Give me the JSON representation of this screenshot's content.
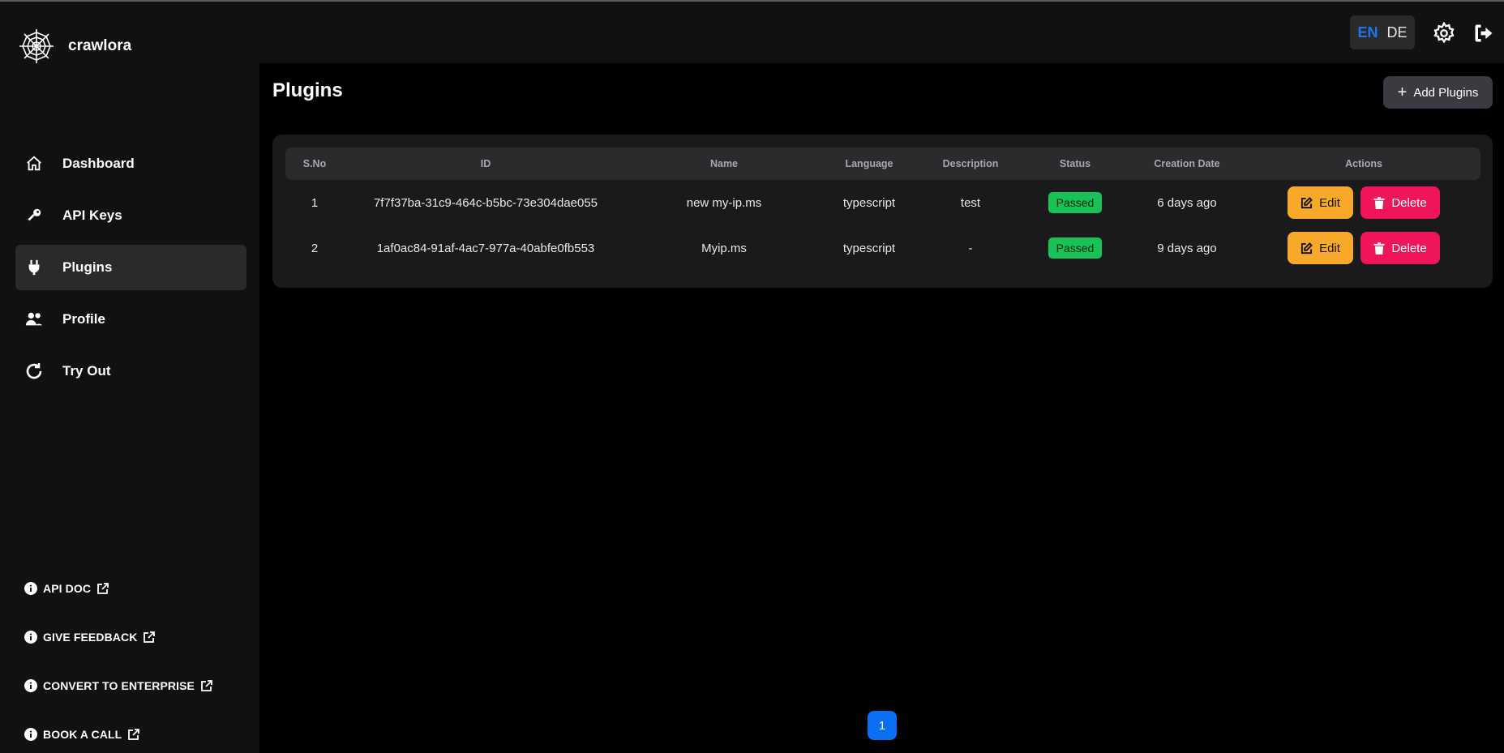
{
  "app": {
    "name": "crawlora"
  },
  "sidebar": {
    "items": [
      {
        "label": "Dashboard",
        "icon": "home-icon"
      },
      {
        "label": "API Keys",
        "icon": "key-icon"
      },
      {
        "label": "Plugins",
        "icon": "plug-icon",
        "active": true
      },
      {
        "label": "Profile",
        "icon": "users-icon"
      },
      {
        "label": "Try Out",
        "icon": "refresh-icon"
      }
    ],
    "links": [
      {
        "label": "API DOC"
      },
      {
        "label": "GIVE FEEDBACK"
      },
      {
        "label": "CONVERT TO ENTERPRISE"
      },
      {
        "label": "BOOK A CALL"
      }
    ]
  },
  "header": {
    "lang": {
      "en": "EN",
      "de": "DE",
      "selected": "EN"
    }
  },
  "page": {
    "title": "Plugins",
    "add_label": "Add Plugins"
  },
  "table": {
    "columns": [
      "S.No",
      "ID",
      "Name",
      "Language",
      "Description",
      "Status",
      "Creation Date",
      "Actions"
    ],
    "rows": [
      {
        "sno": "1",
        "id": "7f7f37ba-31c9-464c-b5bc-73e304dae055",
        "name": "new my-ip.ms",
        "language": "typescript",
        "description": "test",
        "status": "Passed",
        "date": "6 days ago"
      },
      {
        "sno": "2",
        "id": "1af0ac84-91af-4ac7-977a-40abfe0fb553",
        "name": "Myip.ms",
        "language": "typescript",
        "description": "-",
        "status": "Passed",
        "date": "9 days ago"
      }
    ],
    "edit_label": "Edit",
    "delete_label": "Delete"
  },
  "pagination": {
    "current": "1"
  },
  "colors": {
    "accent": "#0b6ff1",
    "status_passed": "#18c257",
    "edit": "#f8a92a",
    "delete": "#f0145a"
  }
}
